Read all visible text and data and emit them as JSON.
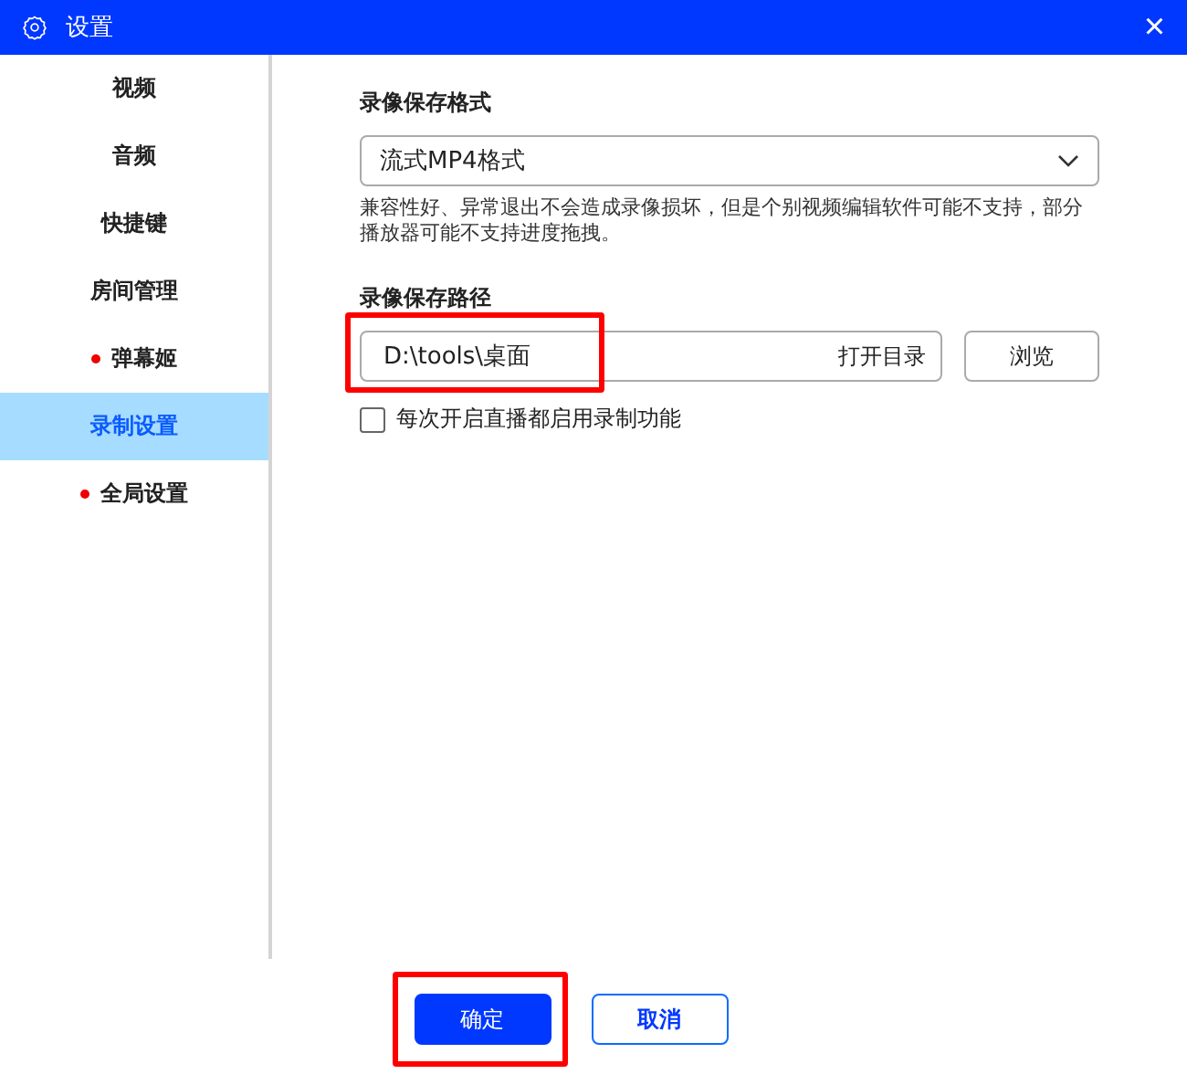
{
  "window": {
    "title": "设置",
    "close": "×"
  },
  "sidebar": {
    "items": [
      {
        "label": "视频",
        "selected": false,
        "badge": false
      },
      {
        "label": "音频",
        "selected": false,
        "badge": false
      },
      {
        "label": "快捷键",
        "selected": false,
        "badge": false
      },
      {
        "label": "房间管理",
        "selected": false,
        "badge": false
      },
      {
        "label": "弹幕姬",
        "selected": false,
        "badge": true
      },
      {
        "label": "录制设置",
        "selected": true,
        "badge": false
      },
      {
        "label": "全局设置",
        "selected": false,
        "badge": true
      }
    ]
  },
  "format": {
    "label": "录像保存格式",
    "value": "流式MP4格式",
    "hint": "兼容性好、异常退出不会造成录像损坏，但是个别视频编辑软件可能不支持，部分播放器可能不支持进度拖拽。"
  },
  "path": {
    "label": "录像保存路径",
    "value": "D:\\tools\\桌面",
    "open_button": "打开目录",
    "browse_button": "浏览",
    "highlighted": true
  },
  "auto_record": {
    "label": "每次开启直播都启用录制功能",
    "checked": false
  },
  "buttons": [
    {
      "label": "确定",
      "kind": "primary",
      "highlighted": true
    },
    {
      "label": "取消",
      "kind": "secondary",
      "highlighted": false
    }
  ]
}
